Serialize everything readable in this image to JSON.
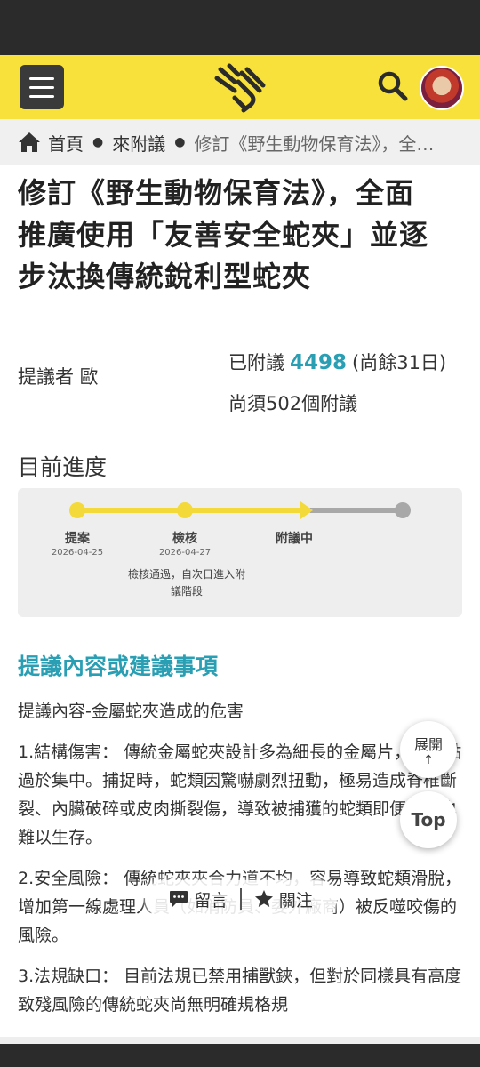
{
  "header": {
    "logo_name": "hands-logo"
  },
  "breadcrumb": {
    "home": "首頁",
    "section": "來附議",
    "current": "修訂《野生動物保育法》，全…"
  },
  "title": "修訂《野生動物保育法》，全面推廣使用「友善安全蛇夾」並逐步汰換傳統銳利型蛇夾",
  "proposer": "提議者 歐",
  "signatures": {
    "prefix": "已附議",
    "count": "4498",
    "remaining": "(尚餘31日)",
    "needed": "尚須502個附議"
  },
  "progress": {
    "title": "目前進度",
    "steps": [
      {
        "label": "提案",
        "date": "2026-04-25"
      },
      {
        "label": "檢核",
        "date": "2026-04-27"
      },
      {
        "label": "附議中",
        "date": ""
      }
    ],
    "note": "檢核通過，自次日進入附議階段"
  },
  "section": {
    "heading": "提議內容或建議事項"
  },
  "content": {
    "p0": "提議內容-金屬蛇夾造成的危害",
    "p1": "1.結構傷害： 傳統金屬蛇夾設計多為細長的金屬片，受力點過於集中。捕捉時，蛇類因驚嚇劇烈扭動，極易造成脊椎斷裂、內臟破碎或皮肉撕裂傷，導致被捕獲的蛇類即便放生也難以生存。",
    "p2": "2.安全風險： 傳統蛇夾夾合力道不均，容易導致蛇類滑脫，增加第一線處理人員（如消防員、委外廠商）被反噬咬傷的風險。",
    "p3": "3.法規缺口： 目前法規已禁用捕獸鋏，但對於同樣具有高度致殘風險的傳統蛇夾尚無明確規格規"
  },
  "floating": {
    "expand": "展開",
    "expand_arrow": "↑",
    "top": "Top"
  },
  "actions": {
    "comment": "留言",
    "follow": "關注"
  },
  "colors": {
    "brand_yellow": "#f7e13a",
    "accent_teal": "#2a9fb4",
    "dark": "#2b2b2b"
  }
}
